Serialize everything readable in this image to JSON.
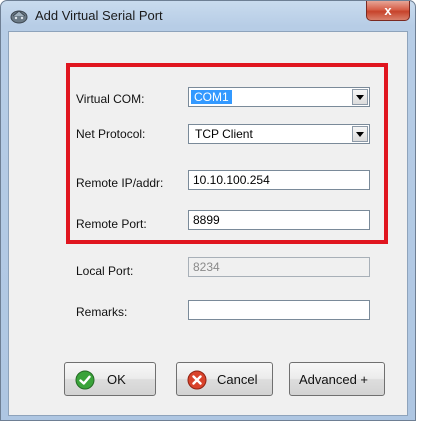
{
  "window": {
    "title": "Add Virtual Serial Port",
    "close_glyph": "x",
    "title_icon": "serial-port-icon"
  },
  "form": {
    "virtual_com": {
      "label": "Virtual COM:",
      "value": "COM1"
    },
    "net_protocol": {
      "label": "Net Protocol:",
      "value": "TCP Client"
    },
    "remote_ip": {
      "label": "Remote IP/addr:",
      "value": "10.10.100.254"
    },
    "remote_port": {
      "label": "Remote Port:",
      "value": "8899"
    },
    "local_port": {
      "label": "Local Port:",
      "value": "8234"
    },
    "remarks": {
      "label": "Remarks:",
      "value": ""
    }
  },
  "buttons": {
    "ok": "OK",
    "cancel": "Cancel",
    "advanced": "Advanced +"
  },
  "colors": {
    "highlight": "#e0151f",
    "ok_icon": "#3aa33a",
    "cancel_icon": "#d9432b",
    "selection": "#3399ff"
  }
}
